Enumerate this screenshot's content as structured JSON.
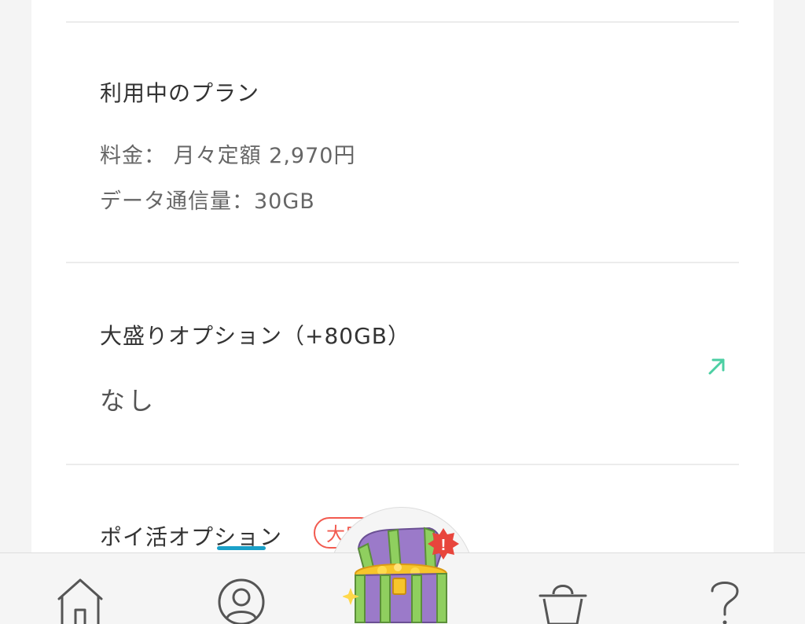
{
  "plan": {
    "title": "利用中のプラン",
    "fee_line": "料金： 月々定額 2,970円",
    "data_line": "データ通信量：30GB"
  },
  "option_large": {
    "title": "大盛りオプション（+80GB）",
    "value": "なし",
    "link_icon": "external-link-arrow-icon"
  },
  "option_poi": {
    "title": "ポイ活オプション",
    "badge": "大口"
  },
  "nav": {
    "items": [
      {
        "icon": "home-icon"
      },
      {
        "icon": "account-icon"
      },
      {
        "icon": "treasure-chest-icon",
        "alert": "!"
      },
      {
        "icon": "shopping-basket-icon"
      },
      {
        "icon": "help-icon"
      }
    ]
  },
  "colors": {
    "accent": "#4ccfa3",
    "badge": "#f25a4f",
    "underline": "#1aa0c8"
  }
}
